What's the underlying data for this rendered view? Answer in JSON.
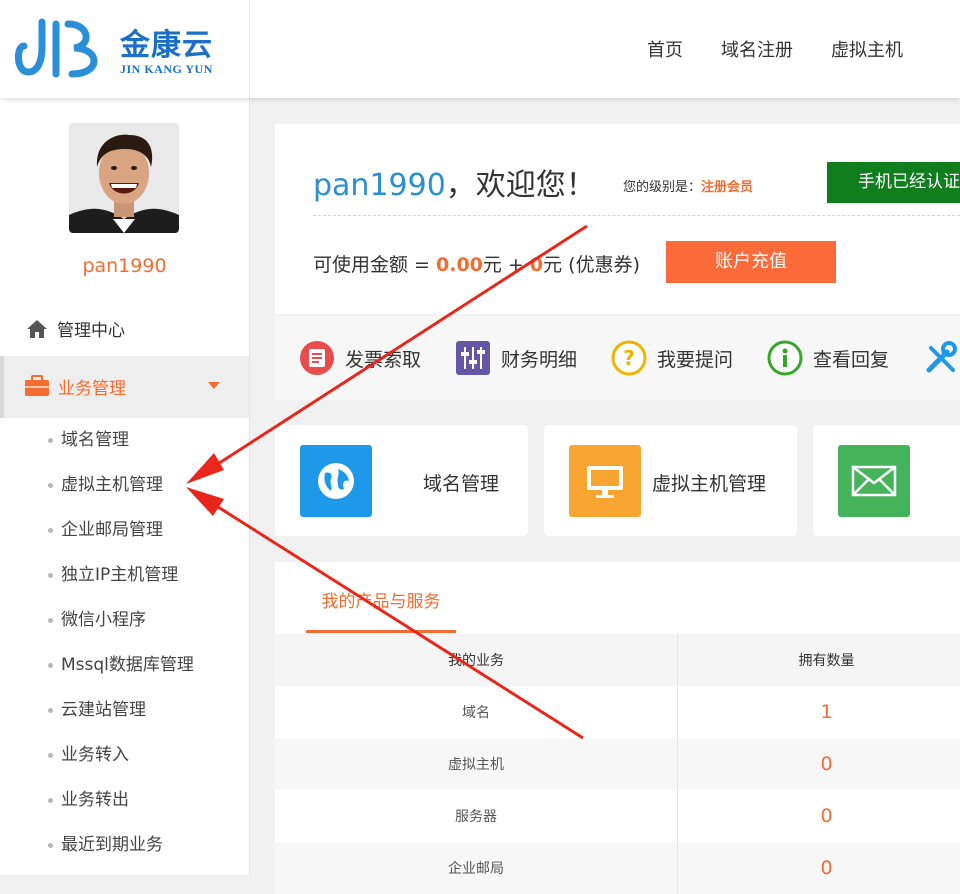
{
  "brand": {
    "name_cn": "金康云",
    "name_en": "JIN KANG YUN",
    "primary": "#1b6fc6",
    "accent": "#f46c2f"
  },
  "topnav": [
    "首页",
    "域名注册",
    "虚拟主机"
  ],
  "sidebar": {
    "username": "pan1990",
    "home_label": "管理中心",
    "home_icon": "home-icon",
    "business_label": "业务管理",
    "business_icon": "briefcase-icon",
    "submenu": [
      "域名管理",
      "虚拟主机管理",
      "企业邮局管理",
      "独立IP主机管理",
      "微信小程序",
      "Mssql数据库管理",
      "云建站管理",
      "业务转入",
      "业务转出",
      "最近到期业务"
    ]
  },
  "welcome": {
    "username": "pan1990",
    "greeting": "，欢迎您！",
    "level_prefix": "您的级别是：",
    "level_value": "注册会员",
    "verified_label": "手机已经认证",
    "balance_prefix": "可使用金额 = ",
    "balance_amount": "0.00",
    "balance_mid": "元 + ",
    "coupon_amount": "0",
    "balance_suffix": "元 (优惠券)",
    "recharge_label": "账户充值"
  },
  "quick_links": [
    {
      "label": "发票索取",
      "icon": "invoice-icon",
      "color": "#e84c4c"
    },
    {
      "label": "财务明细",
      "icon": "sliders-icon",
      "color": "#6656a8"
    },
    {
      "label": "我要提问",
      "icon": "question-icon",
      "color": "#f0b400"
    },
    {
      "label": "查看回复",
      "icon": "info-icon",
      "color": "#3aa52d"
    }
  ],
  "tiles": [
    {
      "label": "域名管理",
      "icon": "globe-icon",
      "color": "#1e98e8"
    },
    {
      "label": "虚拟主机管理",
      "icon": "monitor-icon",
      "color": "#f7a530"
    },
    {
      "label": "",
      "icon": "mail-icon",
      "color": "#44b35a"
    }
  ],
  "products": {
    "tab_label": "我的产品与服务",
    "headers": [
      "我的业务",
      "拥有数量"
    ],
    "rows": [
      {
        "name": "域名",
        "count": "1"
      },
      {
        "name": "虚拟主机",
        "count": "0"
      },
      {
        "name": "服务器",
        "count": "0"
      },
      {
        "name": "企业邮局",
        "count": "0"
      }
    ]
  }
}
